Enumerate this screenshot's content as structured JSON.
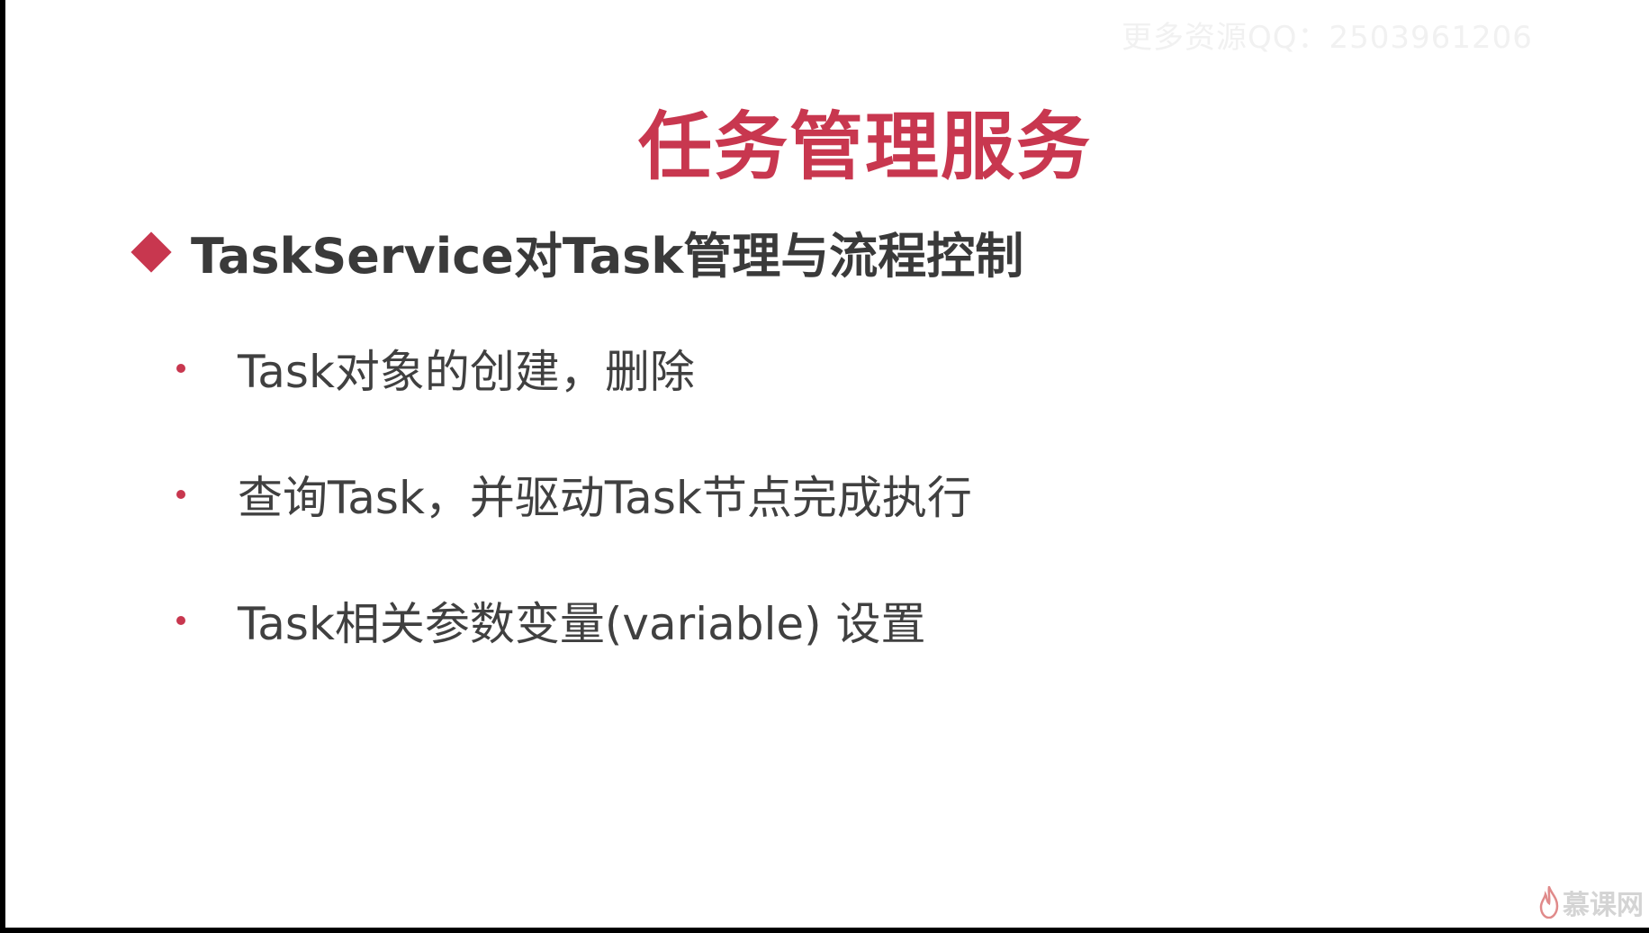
{
  "watermark": "更多资源QQ：2503961206",
  "slide": {
    "title": "任务管理服务",
    "heading": "TaskService对Task管理与流程控制",
    "bullets": [
      "Task对象的创建，删除",
      "查询Task，并驱动Task节点完成执行",
      "Task相关参数变量(variable) 设置"
    ]
  },
  "brand": {
    "name": "慕课网",
    "icon": "flame-icon"
  },
  "colors": {
    "accent": "#c8374f",
    "text": "#404040",
    "background": "#ffffff"
  }
}
